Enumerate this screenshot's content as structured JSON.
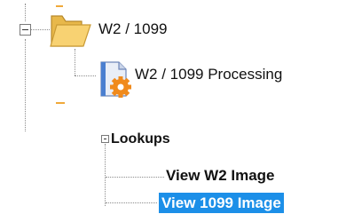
{
  "tree1": {
    "root_label": "W2 / 1099",
    "child_label": "W2 / 1099 Processing"
  },
  "tree2": {
    "group_label": "Lookups",
    "items": [
      {
        "label": "View W2 Image",
        "selected": false
      },
      {
        "label": "View 1099 Image",
        "selected": true
      }
    ]
  },
  "colors": {
    "selection": "#1c8fe8",
    "folder": "#f6c85a",
    "gear": "#f08a1c",
    "accent_dash": "#f0a93a"
  }
}
